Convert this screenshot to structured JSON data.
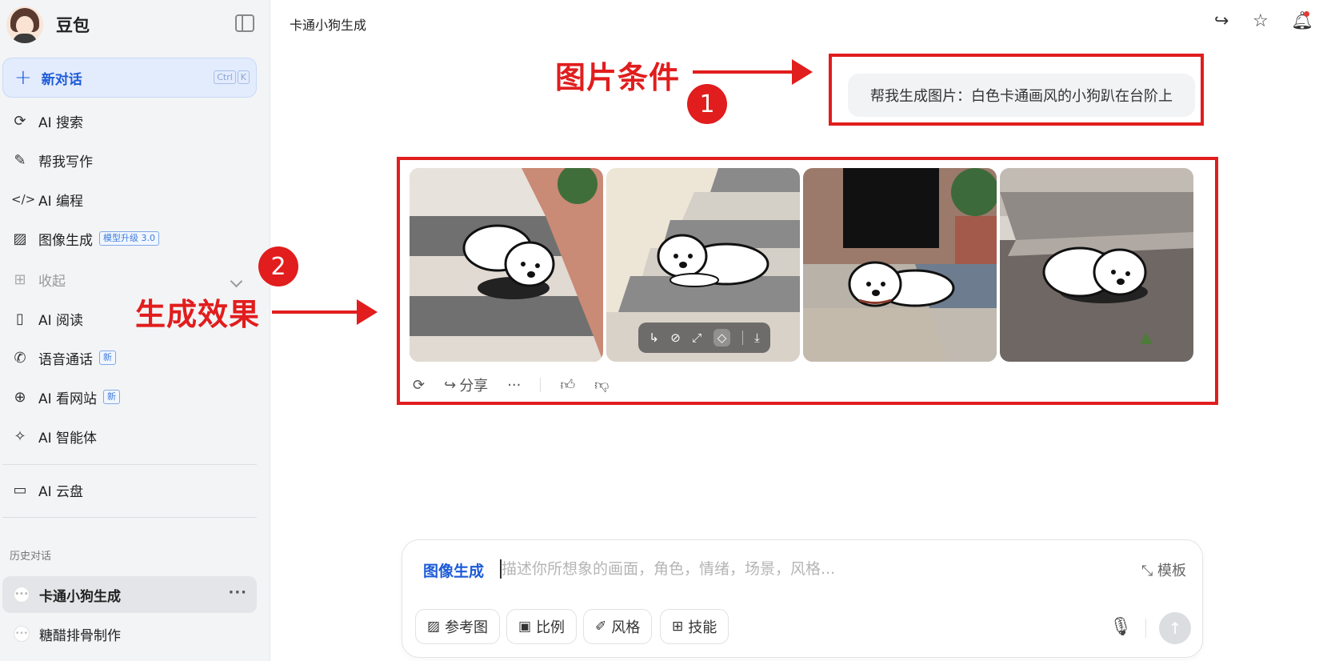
{
  "sidebar": {
    "brand": "豆包",
    "new_chat": {
      "label": "新对话",
      "shortcut": [
        "Ctrl",
        "K"
      ]
    },
    "nav": [
      {
        "label": "AI 搜索",
        "icon": "search-spark-icon"
      },
      {
        "label": "帮我写作",
        "icon": "pen-icon"
      },
      {
        "label": "AI 编程",
        "icon": "code-icon"
      },
      {
        "label": "图像生成",
        "icon": "image-icon",
        "tag": "模型升级 3.0"
      },
      {
        "label": "收起",
        "icon": "grid-icon"
      },
      {
        "label": "AI 阅读",
        "icon": "book-icon"
      },
      {
        "label": "语音通话",
        "icon": "phone-icon",
        "tag": "新"
      },
      {
        "label": "AI 看网站",
        "icon": "globe-icon",
        "tag": "新"
      },
      {
        "label": "AI 智能体",
        "icon": "sparkle-icon"
      },
      {
        "label": "AI 云盘",
        "icon": "cloud-folder-icon"
      }
    ],
    "history_heading": "历史对话",
    "history": [
      {
        "label": "卡通小狗生成",
        "active": true
      },
      {
        "label": "糖醋排骨制作",
        "active": false
      }
    ]
  },
  "header": {
    "title": "卡通小狗生成"
  },
  "annotations": {
    "label1": "图片条件",
    "label2": "生成效果",
    "badge1": "1",
    "badge2": "2",
    "color": "#e11d1d"
  },
  "conversation": {
    "user_message": "帮我生成图片：白色卡通画风的小狗趴在台阶上",
    "actions": {
      "share": "分享",
      "more": "···"
    }
  },
  "composer": {
    "mode": "图像生成",
    "placeholder": "描述你所想象的画面，角色，情绪，场景，风格...",
    "template": "模板",
    "chips": [
      "参考图",
      "比例",
      "风格",
      "技能"
    ]
  },
  "colors": {
    "accent": "#1d5bd8",
    "sidebar_bg": "#f3f4f6",
    "annotation": "#e11d1d"
  }
}
